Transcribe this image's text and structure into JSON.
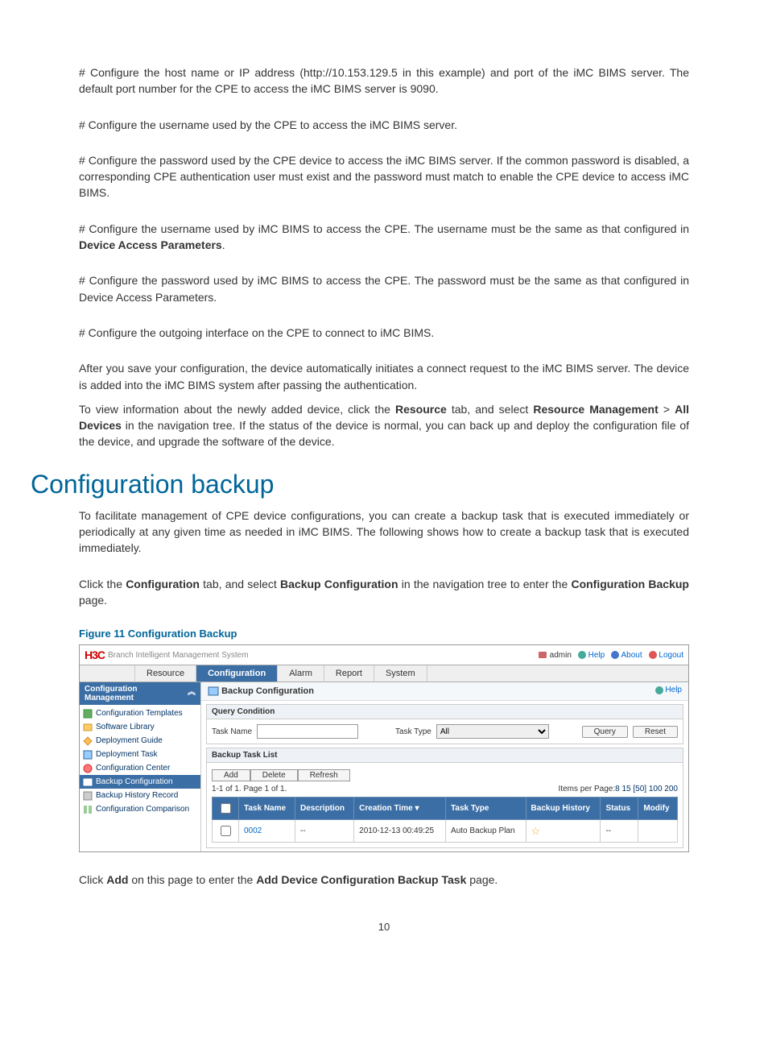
{
  "paragraphs": {
    "p1": "# Configure the host name or IP address (http://10.153.129.5 in this example) and port of the iMC BIMS server. The default port number for the CPE to access the iMC BIMS server is 9090.",
    "p2": "# Configure the username used by the CPE to access the iMC BIMS server.",
    "p3": "# Configure the password used by the CPE device to access the iMC BIMS server. If the common password is disabled, a corresponding CPE authentication user must exist and the password must match to enable the CPE device to access iMC BIMS.",
    "p4_a": "# Configure the username used by iMC BIMS to access the CPE. The username must be the same as that configured in ",
    "p4_b": "Device Access Parameters",
    "p4_c": ".",
    "p5": "# Configure the password used by iMC BIMS to access the CPE. The password must be the same as that configured in Device Access Parameters.",
    "p6": "# Configure the outgoing interface on the CPE to connect to iMC BIMS.",
    "p7": "After you save your configuration, the device automatically initiates a connect request to the iMC BIMS server. The device is added into the iMC BIMS system after passing the authentication.",
    "p8_a": "To view information about the newly added device, click the ",
    "p8_b": "Resource",
    "p8_c": " tab, and select ",
    "p8_d": "Resource Management",
    "p8_e": " > ",
    "p8_f": "All Devices",
    "p8_g": " in the navigation tree. If the status of the device is normal, you can back up and deploy the configuration file of the device, and upgrade the software of the device.",
    "h1": "Configuration backup",
    "p9": "To facilitate management of CPE device configurations, you can create a backup task that is executed immediately or periodically at any given time as needed in iMC BIMS. The following shows how to create a backup task that is executed immediately.",
    "p10_a": "Click the ",
    "p10_b": "Configuration",
    "p10_c": " tab, and select ",
    "p10_d": "Backup Configuration",
    "p10_e": " in the navigation tree to enter the ",
    "p10_f": "Configuration Backup",
    "p10_g": " page.",
    "figcap": "Figure 11 Configuration Backup",
    "p11_a": "Click ",
    "p11_b": "Add",
    "p11_c": " on this page to enter the ",
    "p11_d": "Add Device Configuration Backup Task",
    "p11_e": " page.",
    "pagenum": "10"
  },
  "shot": {
    "logo": "H3C",
    "logotext": "Branch Intelligent Management System",
    "user_label": "admin",
    "toplinks": {
      "help": "Help",
      "about": "About",
      "logout": "Logout"
    },
    "tabs": [
      "Resource",
      "Configuration",
      "Alarm",
      "Report",
      "System"
    ],
    "active_tab": "Configuration",
    "sidebar": {
      "title": "Configuration Management",
      "collapse": "︽",
      "items": [
        "Configuration Templates",
        "Software Library",
        "Deployment Guide",
        "Deployment Task",
        "Configuration Center",
        "Backup Configuration",
        "Backup History Record",
        "Configuration Comparison"
      ],
      "active": "Backup Configuration"
    },
    "main": {
      "title": "Backup Configuration",
      "help": "Help",
      "query": {
        "title": "Query Condition",
        "taskname_label": "Task Name",
        "tasktype_label": "Task Type",
        "tasktype_value": "All",
        "query_btn": "Query",
        "reset_btn": "Reset"
      },
      "list": {
        "title": "Backup Task List",
        "add_btn": "Add",
        "delete_btn": "Delete",
        "refresh_btn": "Refresh",
        "pager_left": "1-1 of 1. Page 1 of 1.",
        "pager_right_prefix": "Items per Page:",
        "pager_right_opts": "8 15 [50] 100 200",
        "cols": [
          "Task Name",
          "Description",
          "Creation Time ▾",
          "Task Type",
          "Backup History",
          "Status",
          "Modify"
        ],
        "row": {
          "name": "0002",
          "desc": "--",
          "time": "2010-12-13 00:49:25",
          "type": "Auto Backup Plan",
          "hist": "☆",
          "status": "--",
          "modify": ""
        }
      }
    }
  }
}
